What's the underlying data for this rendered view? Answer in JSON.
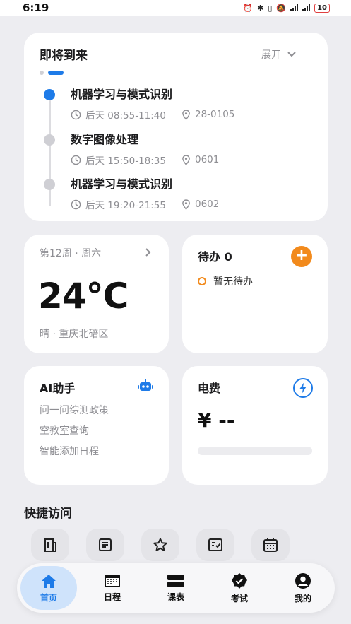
{
  "status_bar": {
    "time": "6:19",
    "battery": "10"
  },
  "upcoming": {
    "title": "即将到来",
    "expand_label": "展开",
    "courses": [
      {
        "name": "机器学习与模式识别",
        "time": "后天 08:55-11:40",
        "location": "28-0105"
      },
      {
        "name": "数字图像处理",
        "time": "后天 15:50-18:35",
        "location": "0601"
      },
      {
        "name": "机器学习与模式识别",
        "time": "后天 19:20-21:55",
        "location": "0602"
      }
    ]
  },
  "week": {
    "label": "第12周 · 周六",
    "temperature": "24°C",
    "weather": "晴 · 重庆北碚区"
  },
  "todo": {
    "title": "待办 0",
    "empty_text": "暂无待办",
    "add_label": "+"
  },
  "ai": {
    "title": "AI助手",
    "items": [
      "问一问综测政策",
      "空教室查询",
      "智能添加日程"
    ]
  },
  "electricity": {
    "title": "电费",
    "value": "¥ --"
  },
  "quick_access": {
    "title": "快捷访问"
  },
  "nav": {
    "home": "首页",
    "schedule": "日程",
    "timetable": "课表",
    "exam": "考试",
    "mine": "我的"
  },
  "colors": {
    "accent": "#1e7be8",
    "orange": "#f28a1c",
    "background": "#ededf1"
  }
}
